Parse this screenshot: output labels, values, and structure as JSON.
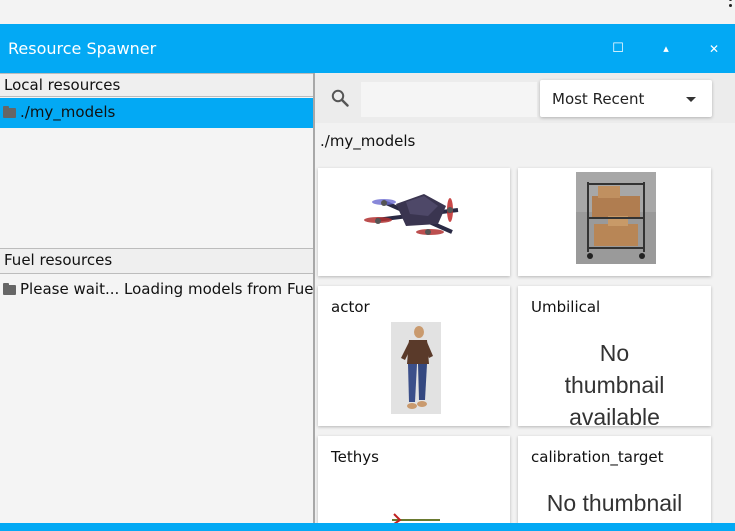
{
  "window": {
    "title": "Resource Spawner",
    "controls": {
      "maximize": "☐",
      "minimize": "▴",
      "close": "✕"
    }
  },
  "left_panel": {
    "local_header": "Local resources",
    "local_items": [
      {
        "label": "./my_models",
        "selected": true,
        "icon": "folder-icon"
      }
    ],
    "fuel_header": "Fuel resources",
    "fuel_items": [
      {
        "label": "Please wait... Loading models from Fuel.",
        "icon": "folder-icon"
      }
    ]
  },
  "right_panel": {
    "search": {
      "value": "",
      "icon": "search-icon"
    },
    "sort": {
      "selected": "Most Recent"
    },
    "path": "./my_models",
    "cards": [
      {
        "name": "",
        "thumbnail": "quadcopter"
      },
      {
        "name": "",
        "thumbnail": "cart-with-boxes"
      },
      {
        "name": "actor",
        "thumbnail": "walking-person"
      },
      {
        "name": "Umbilical",
        "thumbnail": "none",
        "no_thumbnail_text": "No thumbnail available"
      },
      {
        "name": "Tethys",
        "thumbnail": "tethys"
      },
      {
        "name": "calibration_target",
        "thumbnail": "none",
        "no_thumbnail_text": "No thumbnail"
      }
    ]
  },
  "colors": {
    "accent": "#03a9f4",
    "panel_bg": "#f2f2f2",
    "card_bg": "#ffffff"
  }
}
